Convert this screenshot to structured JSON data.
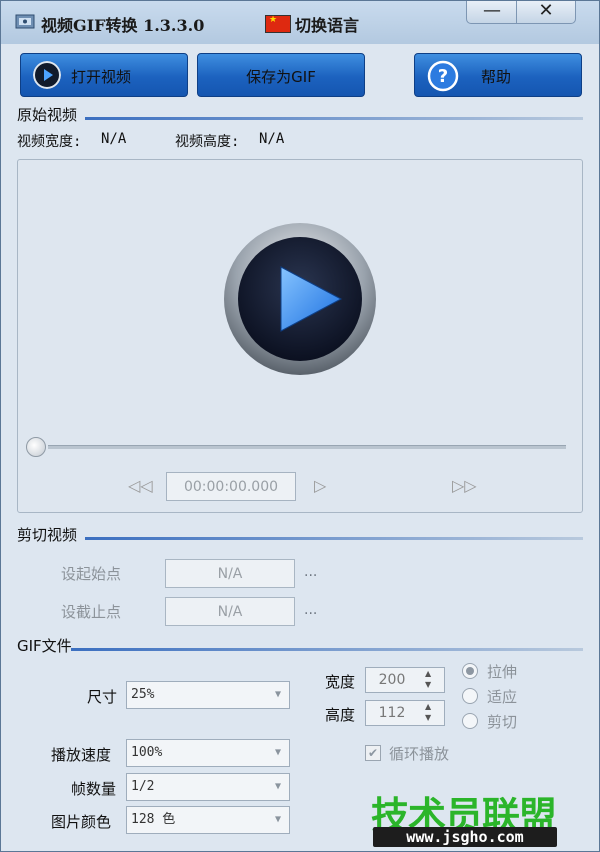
{
  "window": {
    "title": "视频GIF转换 1.3.3.0",
    "language_label": "切换语言",
    "minimize_glyph": "—",
    "close_glyph": "✕"
  },
  "toolbar": {
    "open_label": "打开视频",
    "save_label": "保存为GIF",
    "help_label": "帮助",
    "open_icon": "play-circle-icon",
    "help_icon": "question-mark-icon"
  },
  "original": {
    "section_title": "原始视频",
    "width_label": "视频宽度:",
    "width_value": "N/A",
    "height_label": "视频高度:",
    "height_value": "N/A",
    "time_value": "00:00:00.000",
    "rewind_glyph": "◁◁",
    "play_glyph": "▷",
    "forward_glyph": "▷▷"
  },
  "cut": {
    "section_title": "剪切视频",
    "start_label": "设起始点",
    "start_value": "N/A",
    "end_label": "设截止点",
    "end_value": "N/A",
    "dots": "..."
  },
  "gif": {
    "section_title": "GIF文件",
    "size_label": "尺寸",
    "size_value": "25%",
    "width_label": "宽度",
    "width_value": "200",
    "height_label": "高度",
    "height_value": "112",
    "speed_label": "播放速度",
    "speed_value": "100%",
    "frames_label": "帧数量",
    "frames_value": "1/2",
    "color_label": "图片颜色",
    "color_value": "128 色",
    "radio_stretch": "拉伸",
    "radio_fit": "适应",
    "radio_crop": "剪切",
    "selected_mode": "拉伸",
    "loop_label": "循环播放",
    "loop_checked": true
  },
  "watermark": {
    "brand": "技术员联盟",
    "url": "www.jsgho.com"
  },
  "colors": {
    "accent_blue": "#1c62bf",
    "watermark_green": "#2bb52a"
  }
}
